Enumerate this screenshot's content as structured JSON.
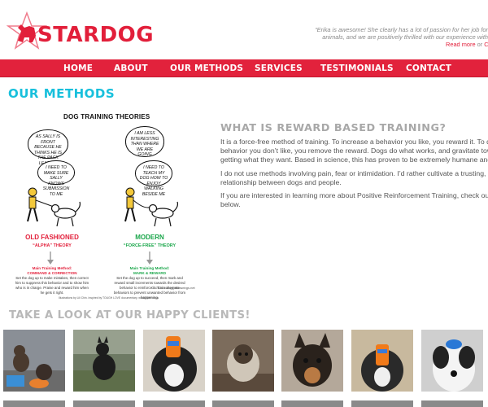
{
  "brand": {
    "name": "STARDOG",
    "logo_color": "#e21f3a",
    "star_color": "#f07b8c"
  },
  "testimonial": {
    "line1": "“Erika is awesome! She clearly has a lot of passion for her job for",
    "line2": "animals, and we are positively thrilled with our experience with",
    "read_more": "Read more",
    "or": "or",
    "cut_word": "Co"
  },
  "nav": {
    "color": "#e2223c",
    "items": [
      {
        "label": "HOME"
      },
      {
        "label": "ABOUT"
      },
      {
        "label": "OUR METHODS"
      },
      {
        "label": "SERVICES"
      },
      {
        "label": "TESTIMONIALS"
      },
      {
        "label": "CONTACT"
      }
    ]
  },
  "page": {
    "title": "OUR METHODS",
    "title_color": "#18c0dc"
  },
  "infographic": {
    "title": "DOG TRAINING THEORIES",
    "left": {
      "bubble1": "AS SALLY IS FRONT BECAUSE HE THINKS HE IS THE PACK LEADER!",
      "bubble2": "I NEED TO MAKE SURE SALLY KNOWS SUBMISSION TO ME",
      "label_line1": "OLD FASHIONED",
      "sub": "“ALPHA” THEORY",
      "method_line1": "Main Training Method:",
      "method_line2": "COMMAND & CORRECTION",
      "desc": "Set the dog up to make mistakes, then correct him to suppress this behavior and to show him who is in charge. Praise and reward him when he gets it right.",
      "color": "#e21f3a"
    },
    "right": {
      "bubble1": "I AM LESS INTERESTING THAN WHERE WE ARE GOING",
      "bubble2": "I NEED TO TEACH MY DOG HOW TO ENJOY WALKING BESIDE ME",
      "label_line1": "MODERN",
      "sub": "“FORCE-FREE” THEORY",
      "method_line1": "Main Training Method:",
      "method_line2": "MARK & REWARD",
      "desc": "Set the dog up to succeed, then mark and reward small increments towards the desired behavior to reinforce it. Train alternate behaviors to prevent unwanted behavior from happening.",
      "color": "#1aa64a"
    },
    "credit": "Illustrations by Lili Chin. Inspired by TOUGH LOVE documentary. www.lilichin.com",
    "signature": "©2012 Lili doggiedrawings.net"
  },
  "article": {
    "heading": "WHAT IS REWARD BASED TRAINING?",
    "p1_lines": [
      "It is a force-free method of training. To increase a behavior you like, you reward it. To decre",
      "behavior you don’t like, you remove the reward. Dogs do what works, and gravitate toward",
      "getting what they want. Based in science, this has proven to be extremely humane and effe"
    ],
    "p2_lines": [
      "I do not use methods involving pain, fear or intimidation. I’d rather cultivate a trusting, playf",
      "relationship between dogs and people."
    ],
    "p3_lines": [
      "If you are interested in learning more about Positive Reinforcement Training, check out the",
      "below."
    ]
  },
  "clients": {
    "heading": "TAKE A LOOK AT OUR HAPPY CLIENTS!",
    "photos": [
      {
        "alt": "dog on play equipment"
      },
      {
        "alt": "black dog sitting on grass"
      },
      {
        "alt": "dog with toy on head"
      },
      {
        "alt": "puppy looking up"
      },
      {
        "alt": "black and tan dog"
      },
      {
        "alt": "dog with toy on nose"
      },
      {
        "alt": "dog with blue toy on head"
      }
    ]
  }
}
